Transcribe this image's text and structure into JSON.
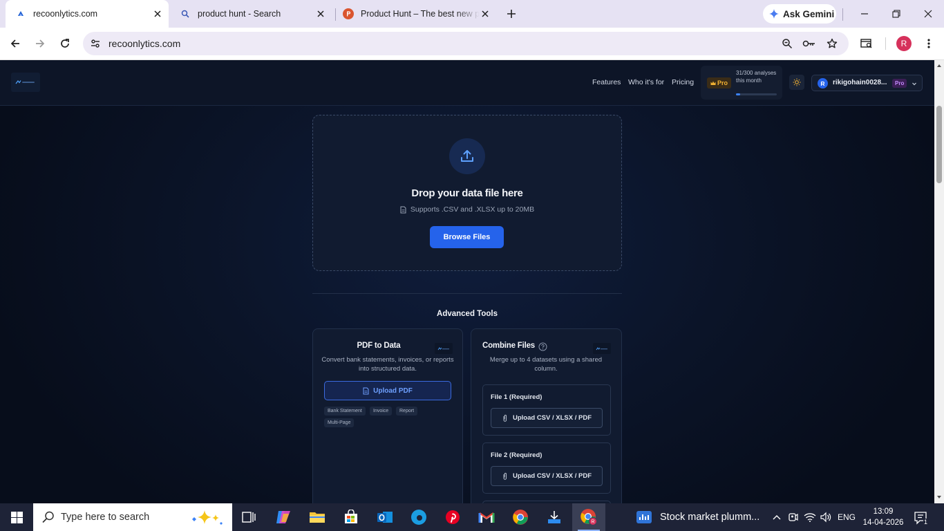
{
  "browser": {
    "tabs": [
      {
        "title": "recoonlytics.com"
      },
      {
        "title": "product hunt - Search"
      },
      {
        "title": "Product Hunt – The best new products in tech."
      }
    ],
    "gemini_label": "Ask Gemini",
    "url": "recoonlytics.com",
    "profile_initial": "R"
  },
  "app": {
    "nav": {
      "features": "Features",
      "who": "Who it's for",
      "pricing": "Pricing"
    },
    "usage": {
      "badge": "Pro",
      "text": "31/300 analyses this month",
      "used": 31,
      "limit": 300
    },
    "user": {
      "initial": "R",
      "name": "rikigohain0028...",
      "plan": "Pro"
    },
    "dropzone": {
      "title": "Drop your data file here",
      "subtitle": "Supports .CSV and .XLSX up to 20MB",
      "button": "Browse Files"
    },
    "advanced_tools_title": "Advanced Tools",
    "pdf_tool": {
      "title": "PDF to Data",
      "description": "Convert bank statements, invoices, or reports into structured data.",
      "button": "Upload PDF",
      "tags": [
        "Bank Statement",
        "Invoice",
        "Report",
        "Multi-Page"
      ]
    },
    "combine_tool": {
      "title": "Combine Files",
      "description": "Merge up to 4 datasets using a shared column.",
      "files": [
        {
          "label": "File 1 (Required)",
          "button": "Upload CSV / XLSX / PDF"
        },
        {
          "label": "File 2 (Required)",
          "button": "Upload CSV / XLSX / PDF"
        }
      ]
    }
  },
  "taskbar": {
    "search_placeholder": "Type here to search",
    "stock_item": "Stock market plumm...",
    "language": "ENG",
    "time": "13:09",
    "date": "14-04-2026",
    "notification_count": "1"
  },
  "colors": {
    "accent": "#2563eb",
    "page_bg": "#0a1020",
    "card_bg": "#111b30",
    "pro_gold": "#f2b233"
  }
}
